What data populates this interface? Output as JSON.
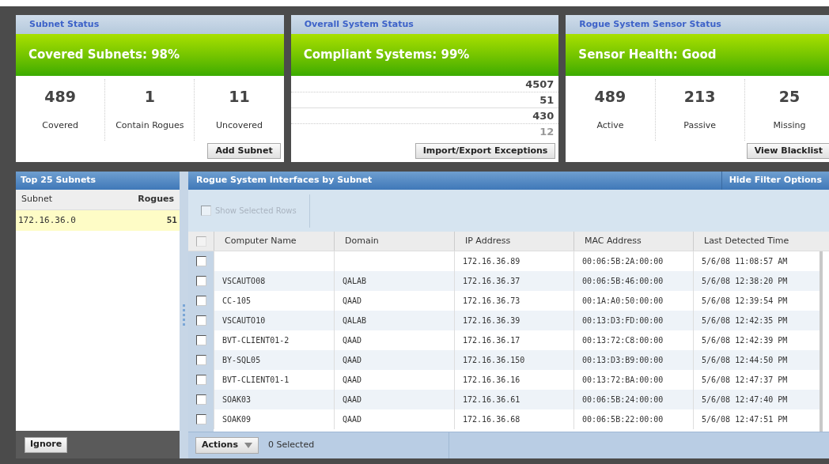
{
  "status_cards": [
    {
      "kind": "stats",
      "title": "Subnet Status",
      "headline": "Covered Subnets: 98%",
      "stats": [
        {
          "value": "489",
          "label": "Covered"
        },
        {
          "value": "1",
          "label": "Contain Rogues"
        },
        {
          "value": "11",
          "label": "Uncovered"
        }
      ],
      "button": "Add Subnet"
    },
    {
      "kind": "list",
      "title": "Overall System Status",
      "headline": "Compliant Systems: 99%",
      "rows": [
        {
          "value": "4507",
          "dim": false
        },
        {
          "value": "51",
          "dim": false
        },
        {
          "value": "430",
          "dim": false
        },
        {
          "value": "12",
          "dim": true
        }
      ],
      "button": "Import/Export Exceptions"
    },
    {
      "kind": "stats",
      "title": "Rogue System Sensor Status",
      "headline": "Sensor Health: Good",
      "stats": [
        {
          "value": "489",
          "label": "Active"
        },
        {
          "value": "213",
          "label": "Passive"
        },
        {
          "value": "25",
          "label": "Missing"
        }
      ],
      "button": "View Blacklist"
    }
  ],
  "subnets_panel": {
    "title": "Top 25 Subnets",
    "columns": [
      "Subnet",
      "Rogues"
    ],
    "rows": [
      {
        "subnet": "172.16.36.0",
        "rogues": "51",
        "selected": true
      }
    ],
    "button": "Ignore"
  },
  "interfaces_panel": {
    "title": "Rogue System Interfaces by Subnet",
    "filter_button": "Hide Filter Options",
    "show_selected": {
      "label": "Show Selected Rows",
      "checked": false
    },
    "columns": [
      "Computer Name",
      "Domain",
      "IP Address",
      "MAC Address",
      "Last Detected Time"
    ],
    "header_checked": false,
    "rows": [
      {
        "checked": false,
        "cells": [
          "",
          "",
          "172.16.36.89",
          "00:06:5B:2A:00:00",
          "5/6/08 11:08:57 AM"
        ]
      },
      {
        "checked": false,
        "cells": [
          "VSCAUTO08",
          "QALAB",
          "172.16.36.37",
          "00:06:5B:46:00:00",
          "5/6/08 12:38:20 PM"
        ]
      },
      {
        "checked": false,
        "cells": [
          "CC-105",
          "QAAD",
          "172.16.36.73",
          "00:1A:A0:50:00:00",
          "5/6/08 12:39:54 PM"
        ]
      },
      {
        "checked": false,
        "cells": [
          "VSCAUTO10",
          "QALAB",
          "172.16.36.39",
          "00:13:D3:FD:00:00",
          "5/6/08 12:42:35 PM"
        ]
      },
      {
        "checked": false,
        "cells": [
          "BVT-CLIENT01-2",
          "QAAD",
          "172.16.36.17",
          "00:13:72:C8:00:00",
          "5/6/08 12:42:39 PM"
        ]
      },
      {
        "checked": false,
        "cells": [
          "BY-SQL05",
          "QAAD",
          "172.16.36.150",
          "00:13:D3:B9:00:00",
          "5/6/08 12:44:50 PM"
        ]
      },
      {
        "checked": false,
        "cells": [
          "BVT-CLIENT01-1",
          "QAAD",
          "172.16.36.16",
          "00:13:72:BA:00:00",
          "5/6/08 12:47:37 PM"
        ]
      },
      {
        "checked": false,
        "cells": [
          "SOAK03",
          "QAAD",
          "172.16.36.61",
          "00:06:5B:24:00:00",
          "5/6/08 12:47:40 PM"
        ]
      },
      {
        "checked": false,
        "cells": [
          "SOAK09",
          "QAAD",
          "172.16.36.68",
          "00:06:5B:22:00:00",
          "5/6/08 12:47:51 PM"
        ]
      }
    ],
    "actions_button": "Actions",
    "selected_count": "0 Selected"
  }
}
